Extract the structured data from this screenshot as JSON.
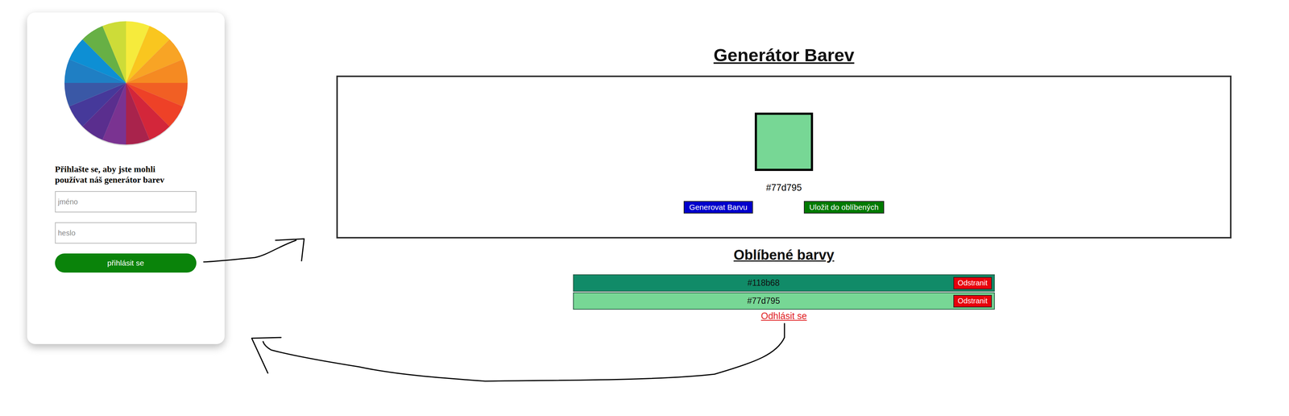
{
  "login": {
    "heading": "Přihlašte se, aby jste mohli používat náš generátor barev",
    "username": {
      "placeholder": "jméno"
    },
    "password": {
      "placeholder": "heslo"
    },
    "button": "přihlásit se"
  },
  "generator": {
    "title": "Generátor Barev",
    "current": {
      "hex": "#77d795",
      "color": "#77d795"
    },
    "buttons": {
      "generate": "Generovat Barvu",
      "save": "Uložit do oblíbených"
    }
  },
  "favorites": {
    "title": "Oblíbené barvy",
    "items": [
      {
        "hex": "#118b68",
        "color": "#118b68",
        "remove": "Odstranit"
      },
      {
        "hex": "#77d795",
        "color": "#77d795",
        "remove": "Odstranit"
      }
    ]
  },
  "logout": "Odhlásit se"
}
